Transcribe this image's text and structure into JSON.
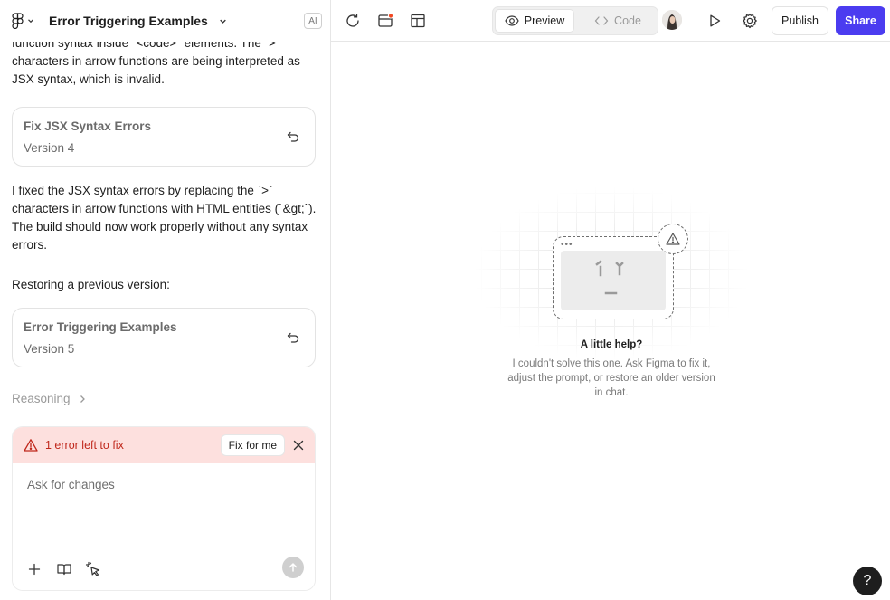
{
  "header": {
    "project_title": "Error Triggering Examples",
    "ai_badge": "AI"
  },
  "chat": {
    "msg1": "function syntax inside `<code>` elements. The `>` characters in arrow functions are being interpreted as JSX syntax, which is invalid.",
    "version_card_1": {
      "title": "Fix JSX Syntax Errors",
      "version": "Version 4"
    },
    "msg2": "I fixed the JSX syntax errors by replacing the `>` characters in arrow functions with HTML entities (`&gt;`). The build should now work properly without any syntax errors.",
    "msg3": "Restoring a previous version:",
    "version_card_2": {
      "title": "Error Triggering Examples",
      "version": "Version 5"
    },
    "reasoning_label": "Reasoning"
  },
  "composer": {
    "error_text": "1 error left to fix",
    "fix_button": "Fix for me",
    "placeholder": "Ask for changes"
  },
  "topbar": {
    "preview_label": "Preview",
    "code_label": "Code",
    "publish_label": "Publish",
    "share_label": "Share",
    "active_tab": "Preview"
  },
  "canvas": {
    "help_title": "A little help?",
    "help_description": "I couldn't solve this one. Ask Figma to fix it, adjust the prompt, or restore an older version in chat.",
    "help_button": "?"
  },
  "colors": {
    "accent": "#4b3cf0",
    "error_bg": "#fde0de",
    "error_text": "#c0281c"
  }
}
